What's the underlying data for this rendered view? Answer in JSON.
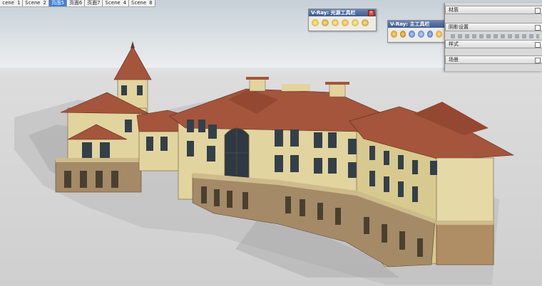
{
  "scene_tabs": [
    {
      "label": "cene 1",
      "active": false
    },
    {
      "label": "Scene 2",
      "active": false
    },
    {
      "label": "页面5",
      "active": true
    },
    {
      "label": "页面6",
      "active": false
    },
    {
      "label": "页面7",
      "active": false
    },
    {
      "label": "Scene 4",
      "active": false
    },
    {
      "label": "Scene 8",
      "active": false
    }
  ],
  "vray_light_toolbar": {
    "title": "V-Ray: 光源工具栏",
    "close_label": "×",
    "icons": [
      "omni-light-icon",
      "spot-light-icon",
      "ies-light-icon",
      "dome-light-icon",
      "sphere-light-icon",
      "mesh-light-icon"
    ]
  },
  "vray_main_toolbar": {
    "title": "V-Ray: 主工具栏",
    "icons": [
      "render-icon",
      "material-editor-icon",
      "options-icon",
      "frame-buffer-icon",
      "interactive-render-icon",
      "help-icon"
    ]
  },
  "tray_panels": [
    {
      "label": "材质"
    },
    {
      "label": "阴影设置"
    },
    {
      "label": "样式"
    },
    {
      "label": "场景"
    }
  ],
  "colors": {
    "roof": "#a4553c",
    "wall": "#e2d49e",
    "stone": "#a48a66",
    "trim": "#cdbb8c",
    "active_tab": "#3f7fd6"
  }
}
